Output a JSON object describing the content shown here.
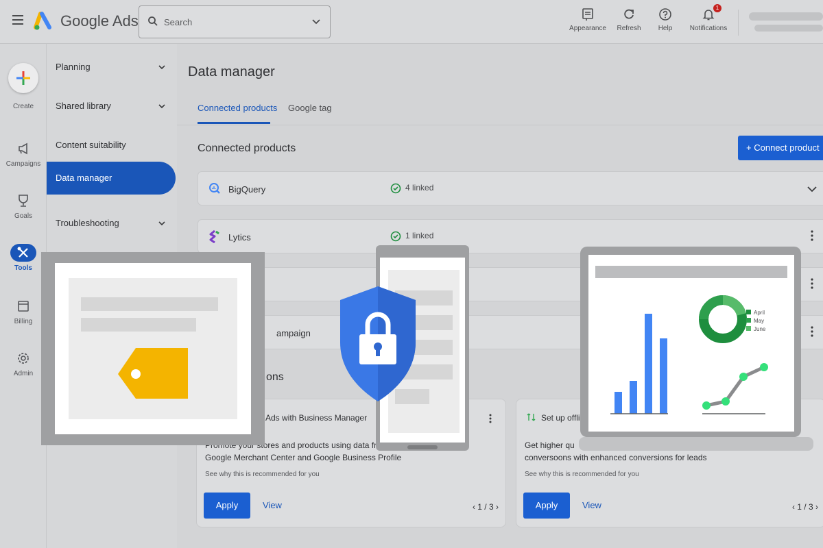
{
  "header": {
    "brand": "Google Ads",
    "search_placeholder": "Search",
    "actions": [
      {
        "label": "Appearance",
        "icon": "appearance-icon"
      },
      {
        "label": "Refresh",
        "icon": "refresh-icon"
      },
      {
        "label": "Help",
        "icon": "help-icon"
      },
      {
        "label": "Notifications",
        "icon": "bell-icon",
        "badge": "1"
      }
    ]
  },
  "rail": {
    "create_label": "Create",
    "items": [
      {
        "label": "Campaigns",
        "icon": "megaphone-icon"
      },
      {
        "label": "Goals",
        "icon": "trophy-icon"
      },
      {
        "label": "Tools",
        "icon": "tools-icon",
        "active": true
      },
      {
        "label": "Billing",
        "icon": "billing-icon"
      },
      {
        "label": "Admin",
        "icon": "gear-icon"
      }
    ]
  },
  "nav": {
    "items": [
      {
        "label": "Planning",
        "expandable": true
      },
      {
        "label": "Shared library",
        "expandable": true
      },
      {
        "label": "Content suitability",
        "expandable": false
      },
      {
        "label": "Data manager",
        "expandable": false,
        "active": true
      },
      {
        "label": "Troubleshooting",
        "expandable": true
      }
    ]
  },
  "main": {
    "title": "Data manager",
    "tabs": [
      {
        "label": "Connected products",
        "active": true
      },
      {
        "label": "Google tag",
        "active": false
      }
    ],
    "section_title": "Connected products",
    "connect_button": "Connect product",
    "products": [
      {
        "name": "BigQuery",
        "status": "4 linked",
        "icon": "bigquery-icon"
      },
      {
        "name": "Lytics",
        "status": "1 linked",
        "icon": "lytics-icon"
      },
      {
        "name": "",
        "status": "",
        "icon": ""
      },
      {
        "name": "ampaign",
        "status": "",
        "icon": ""
      }
    ],
    "recommendations_title": "ons",
    "cards": [
      {
        "title": "Ads with Business Manager",
        "description_line1": "Promote your stores and products using data fr",
        "description_line2": "Google Merchant Center and Google Business Profile",
        "why": "See why this is recommended for you",
        "apply": "Apply",
        "view": "View",
        "pager": "1 / 3"
      },
      {
        "title": "Set up offli",
        "description_line1": "Get higher qu",
        "description_line2": "conversoons with enhanced conversions for leads",
        "why": "See why this is recommended for you",
        "apply": "Apply",
        "view": "View",
        "pager": "1 / 3"
      }
    ]
  },
  "overlay": {
    "legend": [
      "April",
      "May",
      "June"
    ],
    "colors": {
      "accent_blue": "#4285f4",
      "tag_yellow": "#f4b400",
      "green": "#34a853"
    }
  }
}
